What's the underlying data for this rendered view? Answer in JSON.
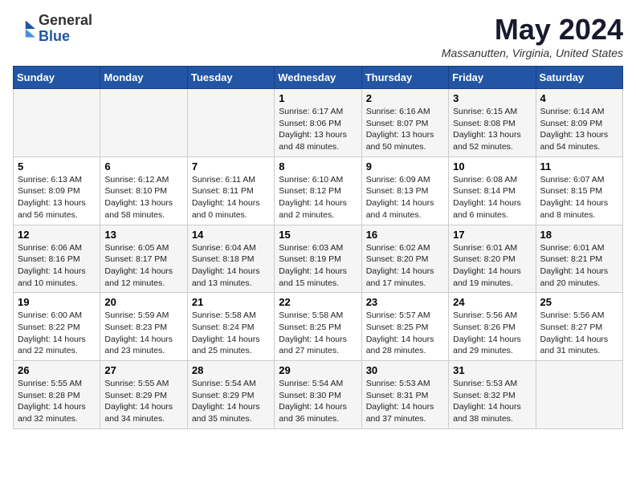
{
  "logo": {
    "general": "General",
    "blue": "Blue"
  },
  "header": {
    "month": "May 2024",
    "location": "Massanutten, Virginia, United States"
  },
  "weekdays": [
    "Sunday",
    "Monday",
    "Tuesday",
    "Wednesday",
    "Thursday",
    "Friday",
    "Saturday"
  ],
  "weeks": [
    [
      {
        "day": "",
        "content": ""
      },
      {
        "day": "",
        "content": ""
      },
      {
        "day": "",
        "content": ""
      },
      {
        "day": "1",
        "content": "Sunrise: 6:17 AM\nSunset: 8:06 PM\nDaylight: 13 hours\nand 48 minutes."
      },
      {
        "day": "2",
        "content": "Sunrise: 6:16 AM\nSunset: 8:07 PM\nDaylight: 13 hours\nand 50 minutes."
      },
      {
        "day": "3",
        "content": "Sunrise: 6:15 AM\nSunset: 8:08 PM\nDaylight: 13 hours\nand 52 minutes."
      },
      {
        "day": "4",
        "content": "Sunrise: 6:14 AM\nSunset: 8:09 PM\nDaylight: 13 hours\nand 54 minutes."
      }
    ],
    [
      {
        "day": "5",
        "content": "Sunrise: 6:13 AM\nSunset: 8:09 PM\nDaylight: 13 hours\nand 56 minutes."
      },
      {
        "day": "6",
        "content": "Sunrise: 6:12 AM\nSunset: 8:10 PM\nDaylight: 13 hours\nand 58 minutes."
      },
      {
        "day": "7",
        "content": "Sunrise: 6:11 AM\nSunset: 8:11 PM\nDaylight: 14 hours\nand 0 minutes."
      },
      {
        "day": "8",
        "content": "Sunrise: 6:10 AM\nSunset: 8:12 PM\nDaylight: 14 hours\nand 2 minutes."
      },
      {
        "day": "9",
        "content": "Sunrise: 6:09 AM\nSunset: 8:13 PM\nDaylight: 14 hours\nand 4 minutes."
      },
      {
        "day": "10",
        "content": "Sunrise: 6:08 AM\nSunset: 8:14 PM\nDaylight: 14 hours\nand 6 minutes."
      },
      {
        "day": "11",
        "content": "Sunrise: 6:07 AM\nSunset: 8:15 PM\nDaylight: 14 hours\nand 8 minutes."
      }
    ],
    [
      {
        "day": "12",
        "content": "Sunrise: 6:06 AM\nSunset: 8:16 PM\nDaylight: 14 hours\nand 10 minutes."
      },
      {
        "day": "13",
        "content": "Sunrise: 6:05 AM\nSunset: 8:17 PM\nDaylight: 14 hours\nand 12 minutes."
      },
      {
        "day": "14",
        "content": "Sunrise: 6:04 AM\nSunset: 8:18 PM\nDaylight: 14 hours\nand 13 minutes."
      },
      {
        "day": "15",
        "content": "Sunrise: 6:03 AM\nSunset: 8:19 PM\nDaylight: 14 hours\nand 15 minutes."
      },
      {
        "day": "16",
        "content": "Sunrise: 6:02 AM\nSunset: 8:20 PM\nDaylight: 14 hours\nand 17 minutes."
      },
      {
        "day": "17",
        "content": "Sunrise: 6:01 AM\nSunset: 8:20 PM\nDaylight: 14 hours\nand 19 minutes."
      },
      {
        "day": "18",
        "content": "Sunrise: 6:01 AM\nSunset: 8:21 PM\nDaylight: 14 hours\nand 20 minutes."
      }
    ],
    [
      {
        "day": "19",
        "content": "Sunrise: 6:00 AM\nSunset: 8:22 PM\nDaylight: 14 hours\nand 22 minutes."
      },
      {
        "day": "20",
        "content": "Sunrise: 5:59 AM\nSunset: 8:23 PM\nDaylight: 14 hours\nand 23 minutes."
      },
      {
        "day": "21",
        "content": "Sunrise: 5:58 AM\nSunset: 8:24 PM\nDaylight: 14 hours\nand 25 minutes."
      },
      {
        "day": "22",
        "content": "Sunrise: 5:58 AM\nSunset: 8:25 PM\nDaylight: 14 hours\nand 27 minutes."
      },
      {
        "day": "23",
        "content": "Sunrise: 5:57 AM\nSunset: 8:25 PM\nDaylight: 14 hours\nand 28 minutes."
      },
      {
        "day": "24",
        "content": "Sunrise: 5:56 AM\nSunset: 8:26 PM\nDaylight: 14 hours\nand 29 minutes."
      },
      {
        "day": "25",
        "content": "Sunrise: 5:56 AM\nSunset: 8:27 PM\nDaylight: 14 hours\nand 31 minutes."
      }
    ],
    [
      {
        "day": "26",
        "content": "Sunrise: 5:55 AM\nSunset: 8:28 PM\nDaylight: 14 hours\nand 32 minutes."
      },
      {
        "day": "27",
        "content": "Sunrise: 5:55 AM\nSunset: 8:29 PM\nDaylight: 14 hours\nand 34 minutes."
      },
      {
        "day": "28",
        "content": "Sunrise: 5:54 AM\nSunset: 8:29 PM\nDaylight: 14 hours\nand 35 minutes."
      },
      {
        "day": "29",
        "content": "Sunrise: 5:54 AM\nSunset: 8:30 PM\nDaylight: 14 hours\nand 36 minutes."
      },
      {
        "day": "30",
        "content": "Sunrise: 5:53 AM\nSunset: 8:31 PM\nDaylight: 14 hours\nand 37 minutes."
      },
      {
        "day": "31",
        "content": "Sunrise: 5:53 AM\nSunset: 8:32 PM\nDaylight: 14 hours\nand 38 minutes."
      },
      {
        "day": "",
        "content": ""
      }
    ]
  ]
}
